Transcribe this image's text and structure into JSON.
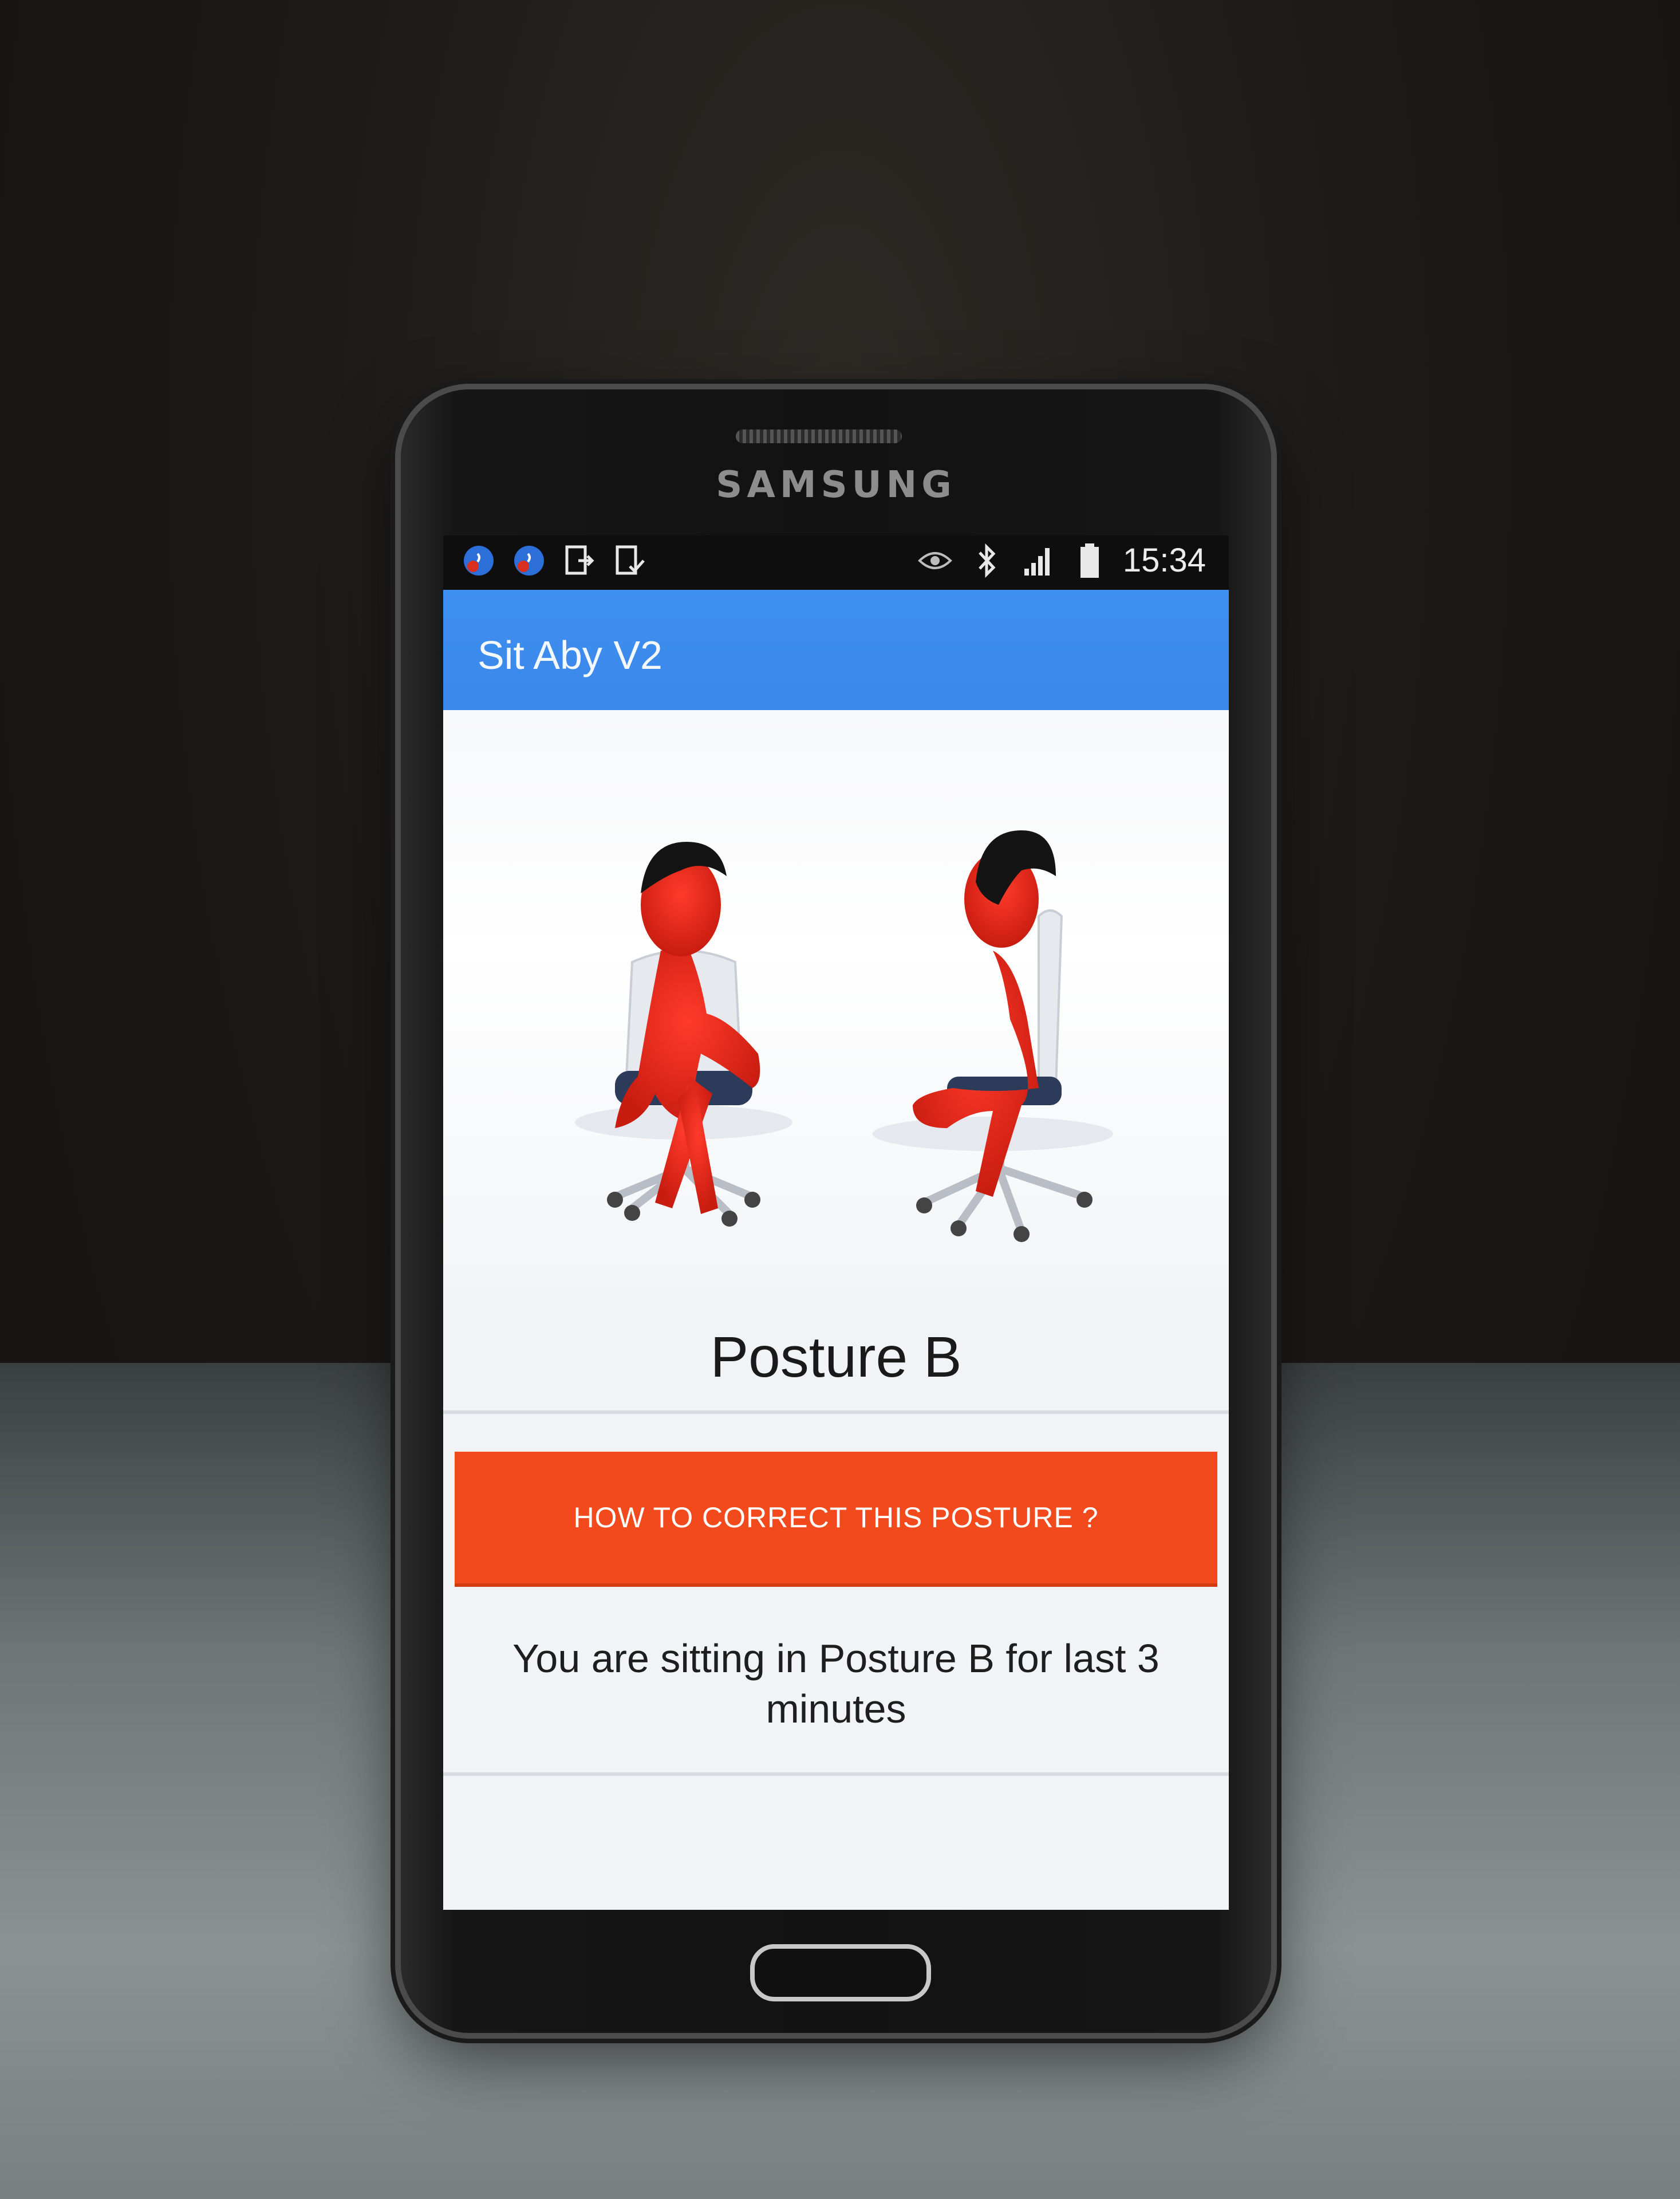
{
  "device": {
    "brand": "SAMSUNG"
  },
  "statusbar": {
    "time": "15:34",
    "left_icons": [
      "app-notification-icon",
      "app-notification-icon",
      "file-export-icon",
      "file-check-icon"
    ],
    "right_icons": [
      "eye-icon",
      "bluetooth-icon",
      "signal-icon",
      "battery-icon"
    ]
  },
  "app": {
    "title": "Sit Aby V2"
  },
  "posture": {
    "name": "Posture B"
  },
  "actions": {
    "correct_label": "HOW TO CORRECT THIS POSTURE ?"
  },
  "status": {
    "message": "You are sitting in Posture B for last 3 minutes"
  },
  "colors": {
    "appbar": "#3f8ff0",
    "action_button": "#f24a1c",
    "figure": "#e8291c",
    "screen_bg": "#f1f3f6"
  }
}
